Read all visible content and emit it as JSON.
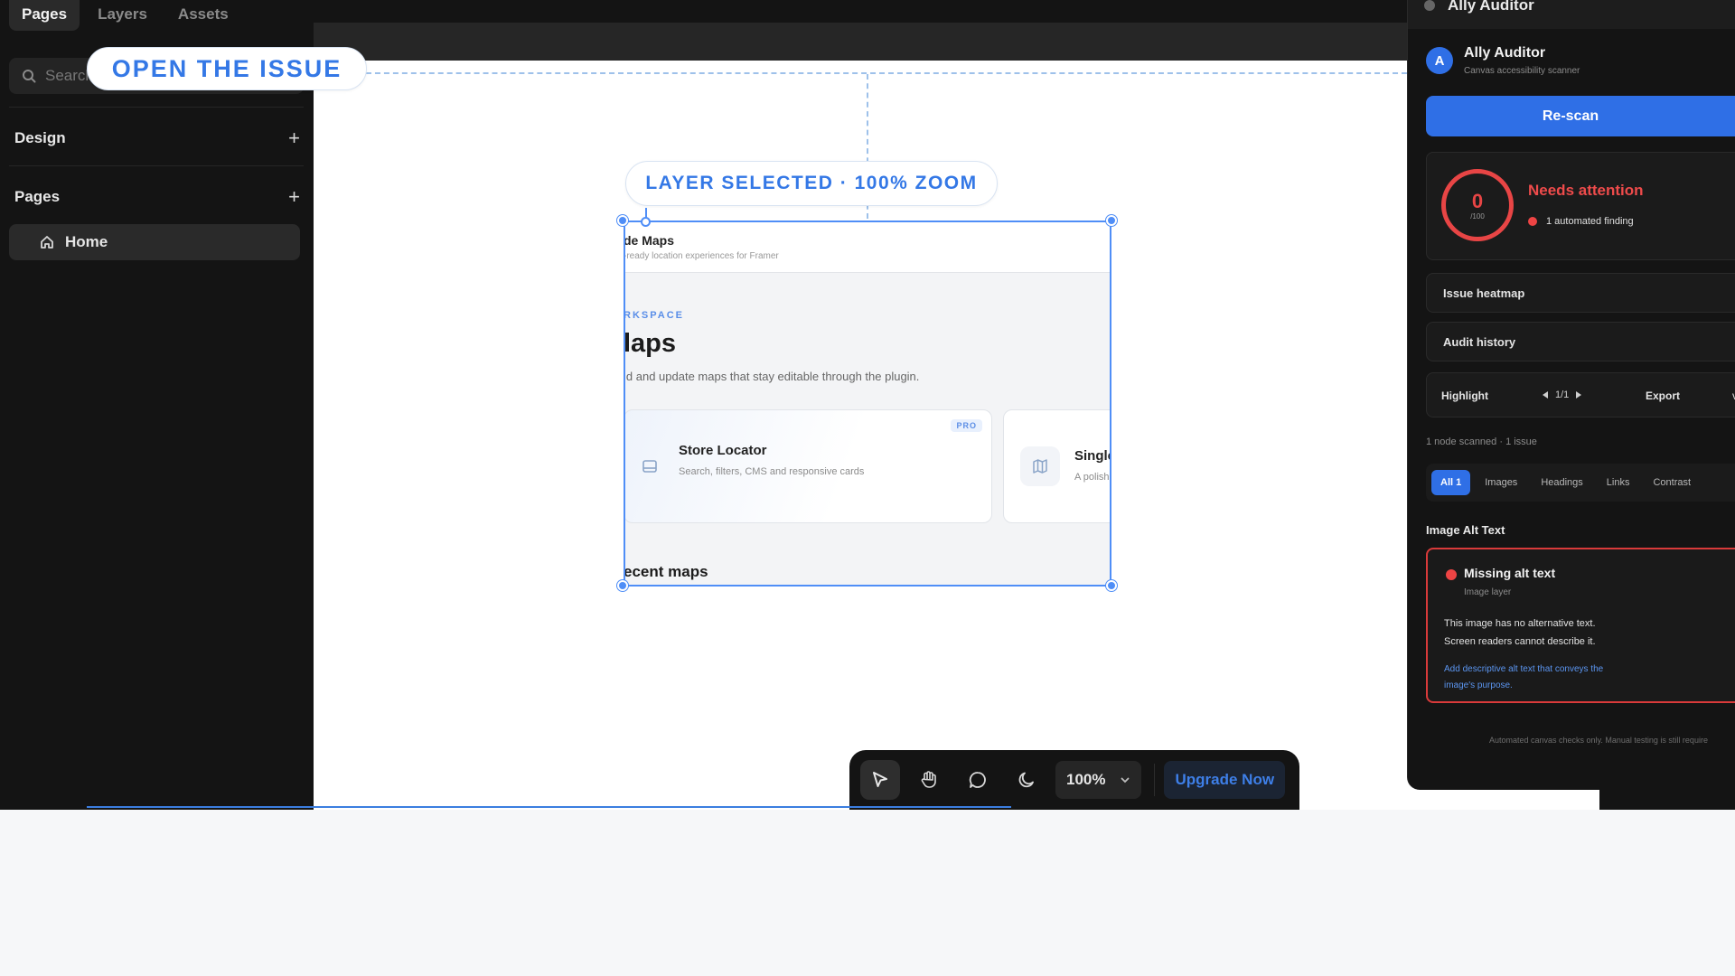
{
  "left_panel": {
    "tabs": [
      "Pages",
      "Layers",
      "Assets"
    ],
    "search_placeholder": "Search",
    "sections": {
      "design": "Design",
      "pages": "Pages"
    },
    "pages": [
      {
        "label": "Home"
      }
    ]
  },
  "overlays": {
    "open_issue": "OPEN THE ISSUE",
    "layer_selected": "LAYER SELECTED · 100% ZOOM"
  },
  "frame_card": {
    "brand": "de Maps",
    "tagline": "-ready location experiences for Framer",
    "kicker": "RKSPACE",
    "title": "laps",
    "description": "ld and update maps that stay editable through the plugin.",
    "tiles": [
      {
        "title": "Store Locator",
        "subtitle": "Search, filters, CMS and responsive cards",
        "badge": "PRO"
      },
      {
        "title": "Single",
        "subtitle": "A polish"
      }
    ],
    "recent": "ecent maps"
  },
  "toolbar": {
    "zoom": "100%",
    "upgrade": "Upgrade Now"
  },
  "ally": {
    "window_title": "Ally Auditor",
    "name": "Ally Auditor",
    "subtitle": "Canvas accessibility scanner",
    "rescan": "Re-scan",
    "score": "0",
    "score_max": "/100",
    "status": "Needs attention",
    "finding": "1 automated finding",
    "heatmap": "Issue heatmap",
    "history": "Audit history",
    "highlight": "Highlight",
    "pager": "1/1",
    "export": "Export",
    "scanned": "1 node scanned · 1 issue",
    "filters": [
      "All 1",
      "Images",
      "Headings",
      "Links",
      "Contrast"
    ],
    "section": "Image Alt Text",
    "issue": {
      "title": "Missing alt text",
      "kind": "Image layer",
      "body": "This image has no alternative text. Screen readers cannot describe it.",
      "fix": "Add descriptive alt text that conveys the image's purpose."
    },
    "footnote": "Automated canvas checks only. Manual testing is still require",
    "colors": {
      "accent": "#2f6fe6",
      "danger": "#e84545"
    }
  }
}
